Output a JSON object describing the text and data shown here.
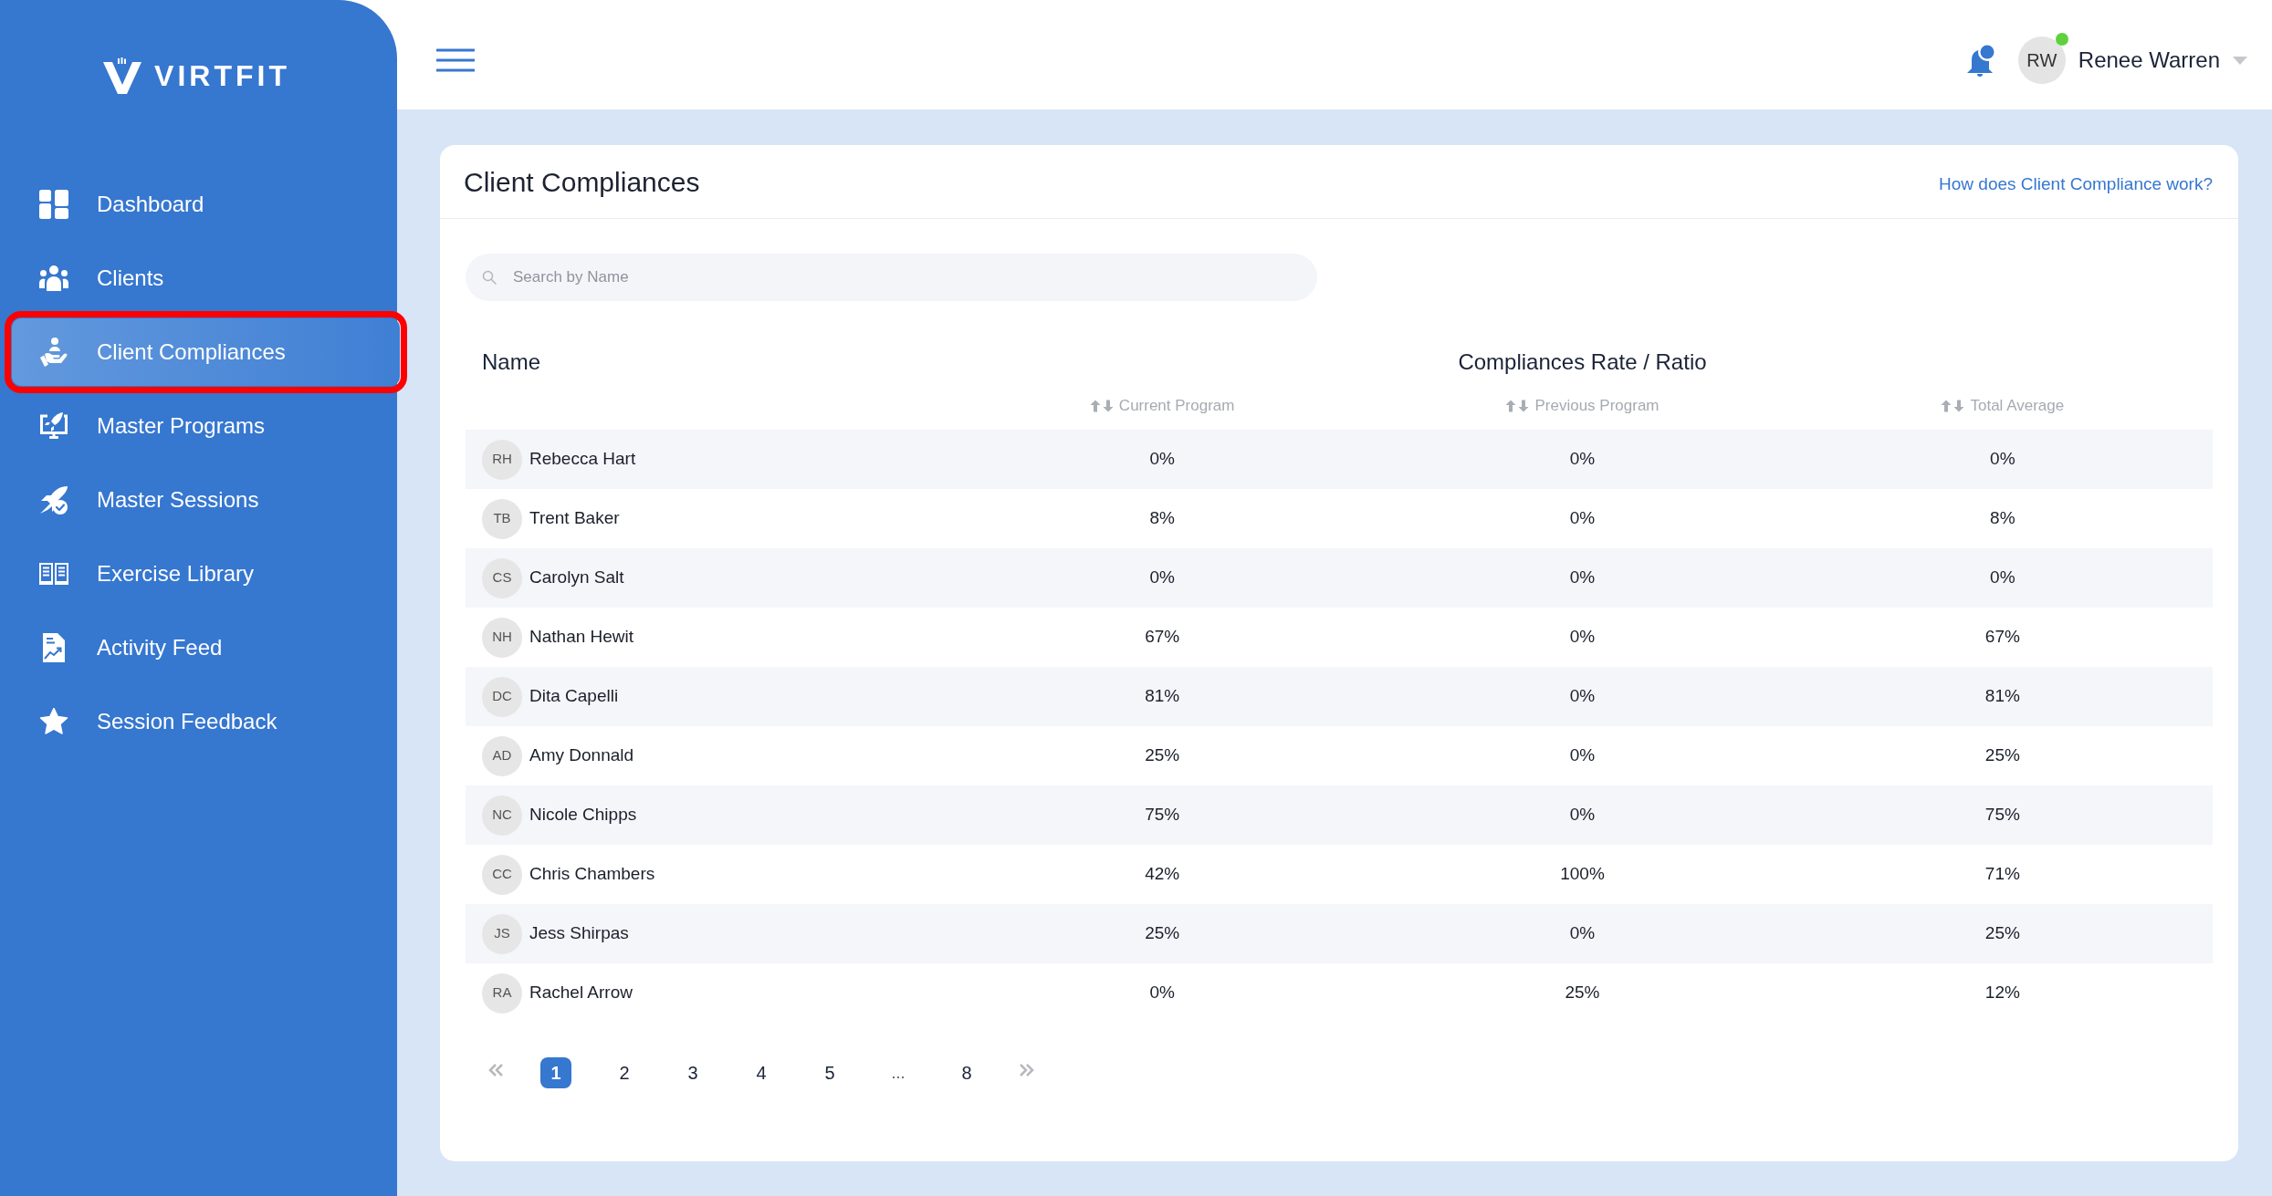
{
  "brand": {
    "name": "VIRTFIT"
  },
  "sidebar": {
    "items": [
      {
        "label": "Dashboard",
        "selected": false,
        "outlined": false
      },
      {
        "label": "Clients",
        "selected": false,
        "outlined": false
      },
      {
        "label": "Client Compliances",
        "selected": true,
        "outlined": true
      },
      {
        "label": "Master Programs",
        "selected": false,
        "outlined": false
      },
      {
        "label": "Master Sessions",
        "selected": false,
        "outlined": false
      },
      {
        "label": "Exercise Library",
        "selected": false,
        "outlined": false
      },
      {
        "label": "Activity Feed",
        "selected": false,
        "outlined": false
      },
      {
        "label": "Session Feedback",
        "selected": false,
        "outlined": false
      }
    ]
  },
  "header": {
    "user": {
      "initials": "RW",
      "name": "Renee Warren",
      "online": true
    }
  },
  "card": {
    "title": "Client Compliances",
    "help_link": "How does Client Compliance work?",
    "search": {
      "placeholder": "Search by Name"
    },
    "table": {
      "name_heading": "Name",
      "group_heading": "Compliances Rate / Ratio",
      "columns": [
        "Current Program",
        "Previous Program",
        "Total Average"
      ],
      "rows": [
        {
          "initials": "RH",
          "name": "Rebecca Hart",
          "values": [
            "0%",
            "0%",
            "0%"
          ]
        },
        {
          "initials": "TB",
          "name": "Trent Baker",
          "values": [
            "8%",
            "0%",
            "8%"
          ]
        },
        {
          "initials": "CS",
          "name": "Carolyn Salt",
          "values": [
            "0%",
            "0%",
            "0%"
          ]
        },
        {
          "initials": "NH",
          "name": "Nathan Hewit",
          "values": [
            "67%",
            "0%",
            "67%"
          ]
        },
        {
          "initials": "DC",
          "name": "Dita Capelli",
          "values": [
            "81%",
            "0%",
            "81%"
          ]
        },
        {
          "initials": "AD",
          "name": "Amy Donnald",
          "values": [
            "25%",
            "0%",
            "25%"
          ]
        },
        {
          "initials": "NC",
          "name": "Nicole Chipps",
          "values": [
            "75%",
            "0%",
            "75%"
          ]
        },
        {
          "initials": "CC",
          "name": "Chris Chambers",
          "values": [
            "42%",
            "100%",
            "71%"
          ]
        },
        {
          "initials": "JS",
          "name": "Jess Shirpas",
          "values": [
            "25%",
            "0%",
            "25%"
          ]
        },
        {
          "initials": "RA",
          "name": "Rachel Arrow",
          "values": [
            "0%",
            "25%",
            "12%"
          ]
        }
      ]
    },
    "pagination": {
      "items": [
        {
          "kind": "page",
          "label": "1",
          "selected": true
        },
        {
          "kind": "page",
          "label": "2",
          "selected": false
        },
        {
          "kind": "page",
          "label": "3",
          "selected": false
        },
        {
          "kind": "page",
          "label": "4",
          "selected": false
        },
        {
          "kind": "page",
          "label": "5",
          "selected": false
        },
        {
          "kind": "gap",
          "label": "...",
          "selected": false
        },
        {
          "kind": "page",
          "label": "8",
          "selected": false
        }
      ]
    }
  }
}
